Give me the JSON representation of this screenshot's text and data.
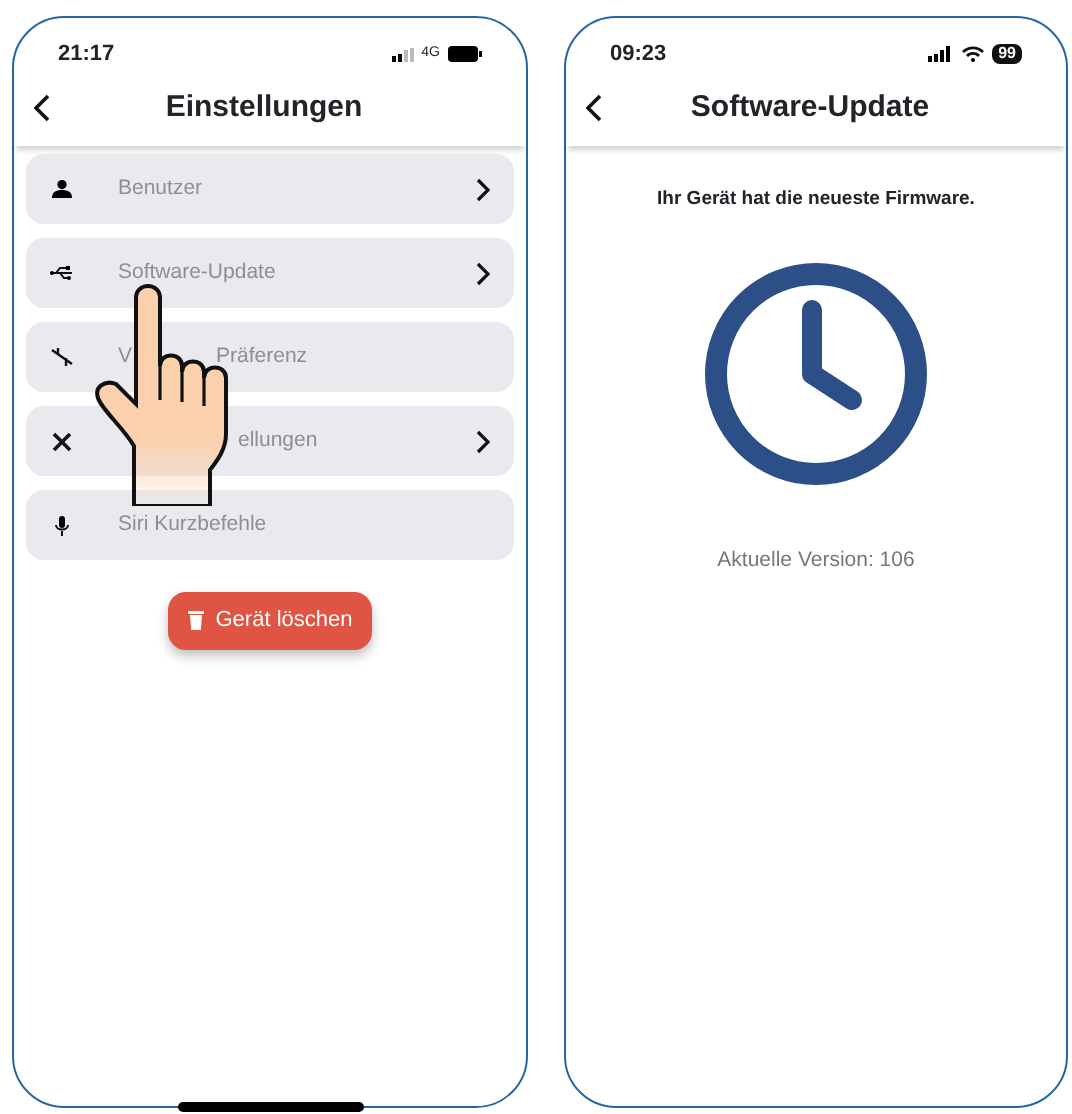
{
  "left_phone": {
    "status_bar": {
      "time": "21:17",
      "network": "4G"
    },
    "nav": {
      "title": "Einstellungen"
    },
    "items": [
      {
        "label": "Benutzer",
        "chevron": true
      },
      {
        "label": "Software-Update",
        "chevron": true
      },
      {
        "label": "V",
        "label_after": "Präferenz",
        "chevron": false
      },
      {
        "label_after": "ellungen",
        "chevron": true
      },
      {
        "label": "Siri Kurzbefehle",
        "chevron": false
      }
    ],
    "delete_button": "Gerät löschen"
  },
  "right_phone": {
    "status_bar": {
      "time": "09:23",
      "battery": "99"
    },
    "nav": {
      "title": "Software-Update"
    },
    "message": "Ihr Gerät hat die neueste Firmware.",
    "version": "Aktuelle Version: 106"
  }
}
